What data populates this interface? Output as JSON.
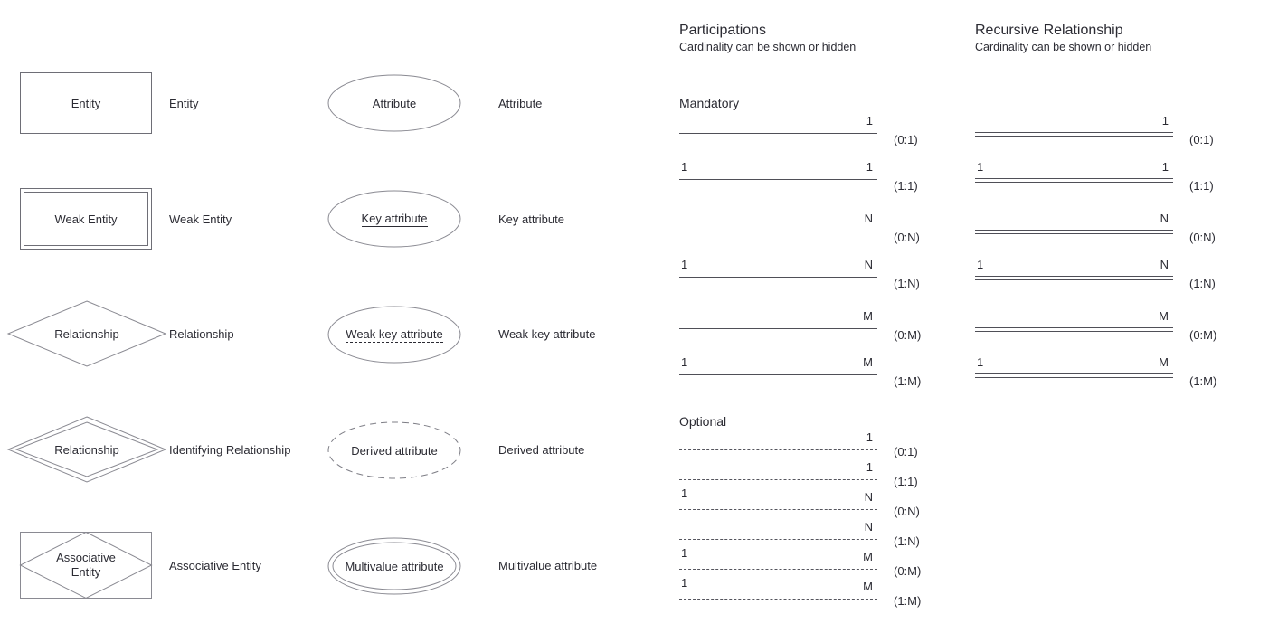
{
  "entity_shapes": [
    {
      "id": "entity",
      "shape": "rectangle",
      "shape_label": "Entity",
      "caption": "Entity"
    },
    {
      "id": "weak-entity",
      "shape": "double-rectangle",
      "shape_label": "Weak Entity",
      "caption": "Weak Entity"
    },
    {
      "id": "relationship",
      "shape": "diamond",
      "shape_label": "Relationship",
      "caption": "Relationship"
    },
    {
      "id": "identifying-relationship",
      "shape": "double-diamond",
      "shape_label": "Relationship",
      "caption": "Identifying Relationship"
    },
    {
      "id": "associative-entity",
      "shape": "rectangle-diamond",
      "shape_label_line1": "Associative",
      "shape_label_line2": "Entity",
      "caption": "Associative Entity"
    }
  ],
  "attribute_shapes": [
    {
      "id": "attribute",
      "shape": "ellipse",
      "shape_label": "Attribute",
      "caption": "Attribute",
      "underline": "none"
    },
    {
      "id": "key-attribute",
      "shape": "ellipse",
      "shape_label": "Key attribute",
      "caption": "Key attribute",
      "underline": "solid"
    },
    {
      "id": "weak-key-attribute",
      "shape": "ellipse",
      "shape_label": "Weak key attribute",
      "caption": "Weak key attribute",
      "underline": "dashed"
    },
    {
      "id": "derived-attribute",
      "shape": "dashed-ellipse",
      "shape_label": "Derived attribute",
      "caption": "Derived attribute",
      "underline": "none"
    },
    {
      "id": "multivalue-attribute",
      "shape": "double-ellipse",
      "shape_label": "Multivalue attribute",
      "caption": "Multivalue attribute",
      "underline": "none"
    }
  ],
  "participations": {
    "title": "Participations",
    "subtitle": "Cardinality can be shown or hidden",
    "mandatory_label": "Mandatory",
    "optional_label": "Optional",
    "mandatory_rows": [
      {
        "left": "",
        "right": "1",
        "pair": "(0:1)",
        "style": "solid"
      },
      {
        "left": "1",
        "right": "1",
        "pair": "(1:1)",
        "style": "solid"
      },
      {
        "left": "",
        "right": "N",
        "pair": "(0:N)",
        "style": "solid"
      },
      {
        "left": "1",
        "right": "N",
        "pair": "(1:N)",
        "style": "solid"
      },
      {
        "left": "",
        "right": "M",
        "pair": "(0:M)",
        "style": "solid"
      },
      {
        "left": "1",
        "right": "M",
        "pair": "(1:M)",
        "style": "solid"
      }
    ],
    "optional_rows": [
      {
        "left": "",
        "right": "1",
        "pair": "(0:1)",
        "style": "dashed"
      },
      {
        "left": "",
        "right": "1",
        "pair": "(1:1)",
        "style": "dashed"
      },
      {
        "left": "1",
        "right": "N",
        "pair": "(0:N)",
        "style": "dashed"
      },
      {
        "left": "",
        "right": "N",
        "pair": "(1:N)",
        "style": "dashed"
      },
      {
        "left": "1",
        "right": "M",
        "pair": "(0:M)",
        "style": "dashed"
      },
      {
        "left": "1",
        "right": "M",
        "pair": "(1:M)",
        "style": "dashed"
      }
    ]
  },
  "recursive": {
    "title": "Recursive Relationship",
    "subtitle": "Cardinality can be shown or hidden",
    "rows": [
      {
        "left": "",
        "right": "1",
        "pair": "(0:1)",
        "style": "double"
      },
      {
        "left": "1",
        "right": "1",
        "pair": "(1:1)",
        "style": "double"
      },
      {
        "left": "",
        "right": "N",
        "pair": "(0:N)",
        "style": "double"
      },
      {
        "left": "1",
        "right": "N",
        "pair": "(1:N)",
        "style": "double"
      },
      {
        "left": "",
        "right": "M",
        "pair": "(0:M)",
        "style": "double"
      },
      {
        "left": "1",
        "right": "M",
        "pair": "(1:M)",
        "style": "double"
      }
    ]
  },
  "colors": {
    "stroke": "#8a8a92",
    "line": "#4f4f57",
    "text": "#2b2b33",
    "background": "#ffffff"
  }
}
